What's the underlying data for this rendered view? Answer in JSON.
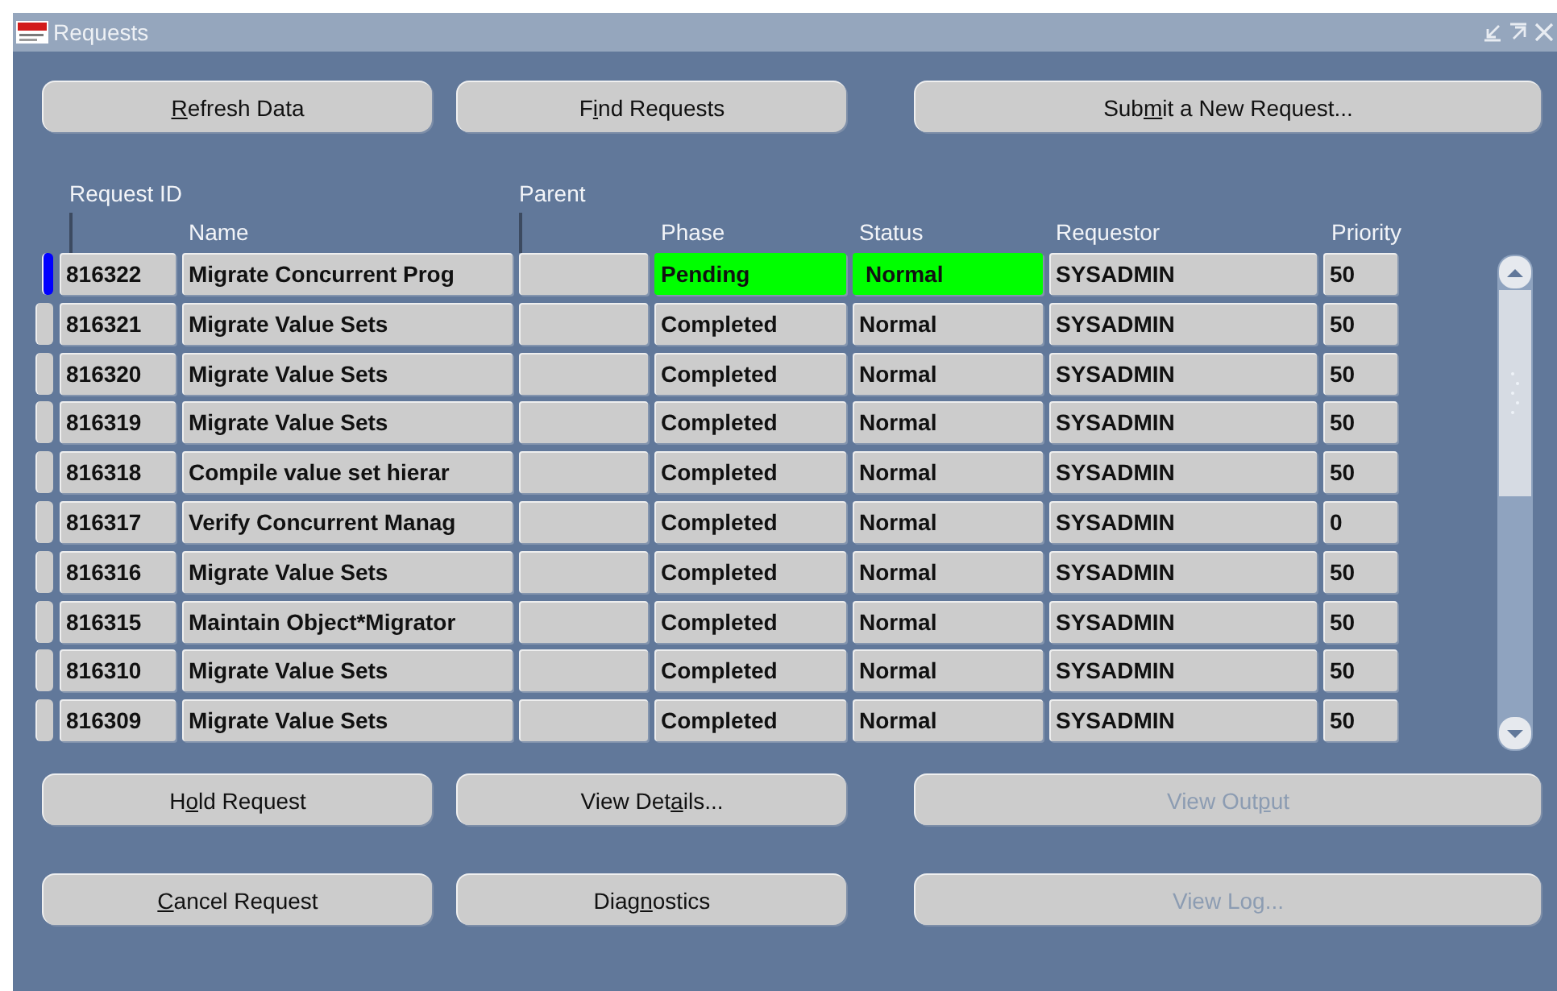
{
  "window": {
    "title": "Requests"
  },
  "top_buttons": [
    {
      "key": "R",
      "after": "efresh Data",
      "disabled": false
    },
    {
      "before": "F",
      "key": "i",
      "after": "nd Requests",
      "disabled": false
    },
    {
      "before": "Sub",
      "key": "m",
      "after": "it a New Request...",
      "disabled": false
    }
  ],
  "table": {
    "header_top": {
      "request_id": "Request ID",
      "parent": "Parent"
    },
    "columns": {
      "name": "Name",
      "phase": "Phase",
      "status": "Status",
      "requestor": "Requestor",
      "priority": "Priority"
    },
    "rows": [
      {
        "selected": true,
        "highlighted": true,
        "request_id": "816322",
        "name": "Migrate Concurrent Prog",
        "phase": "Pending",
        "status": "Normal",
        "requestor": "SYSADMIN",
        "priority": "50"
      },
      {
        "selected": false,
        "highlighted": false,
        "request_id": "816321",
        "name": "Migrate Value Sets",
        "phase": "Completed",
        "status": "Normal",
        "requestor": "SYSADMIN",
        "priority": "50"
      },
      {
        "selected": false,
        "highlighted": false,
        "request_id": "816320",
        "name": "Migrate Value Sets",
        "phase": "Completed",
        "status": "Normal",
        "requestor": "SYSADMIN",
        "priority": "50"
      },
      {
        "selected": false,
        "highlighted": false,
        "request_id": "816319",
        "name": "Migrate Value Sets",
        "phase": "Completed",
        "status": "Normal",
        "requestor": "SYSADMIN",
        "priority": "50"
      },
      {
        "selected": false,
        "highlighted": false,
        "request_id": "816318",
        "name": "Compile value set hierar",
        "phase": "Completed",
        "status": "Normal",
        "requestor": "SYSADMIN",
        "priority": "50"
      },
      {
        "selected": false,
        "highlighted": false,
        "request_id": "816317",
        "name": "Verify Concurrent Manag",
        "phase": "Completed",
        "status": "Normal",
        "requestor": "SYSADMIN",
        "priority": "0"
      },
      {
        "selected": false,
        "highlighted": false,
        "request_id": "816316",
        "name": "Migrate Value Sets",
        "phase": "Completed",
        "status": "Normal",
        "requestor": "SYSADMIN",
        "priority": "50"
      },
      {
        "selected": false,
        "highlighted": false,
        "request_id": "816315",
        "name": "Maintain Object*Migrator",
        "phase": "Completed",
        "status": "Normal",
        "requestor": "SYSADMIN",
        "priority": "50"
      },
      {
        "selected": false,
        "highlighted": false,
        "request_id": "816310",
        "name": "Migrate Value Sets",
        "phase": "Completed",
        "status": "Normal",
        "requestor": "SYSADMIN",
        "priority": "50"
      },
      {
        "selected": false,
        "highlighted": false,
        "request_id": "816309",
        "name": "Migrate Value Sets",
        "phase": "Completed",
        "status": "Normal",
        "requestor": "SYSADMIN",
        "priority": "50"
      }
    ]
  },
  "bottom_buttons": [
    [
      {
        "before": "H",
        "key": "o",
        "after": "ld Request",
        "disabled": false
      },
      {
        "before": "View Det",
        "key": "a",
        "after": "ils...",
        "disabled": false
      },
      {
        "before": "View Out",
        "key": "p",
        "after": "ut",
        "disabled": true
      }
    ],
    [
      {
        "key": "C",
        "after": "ancel Request",
        "disabled": false
      },
      {
        "before": "Diag",
        "key": "n",
        "after": "ostics",
        "disabled": false
      },
      {
        "before": "View Lo",
        "key": "g",
        "after": "...",
        "disabled": true
      }
    ]
  ]
}
